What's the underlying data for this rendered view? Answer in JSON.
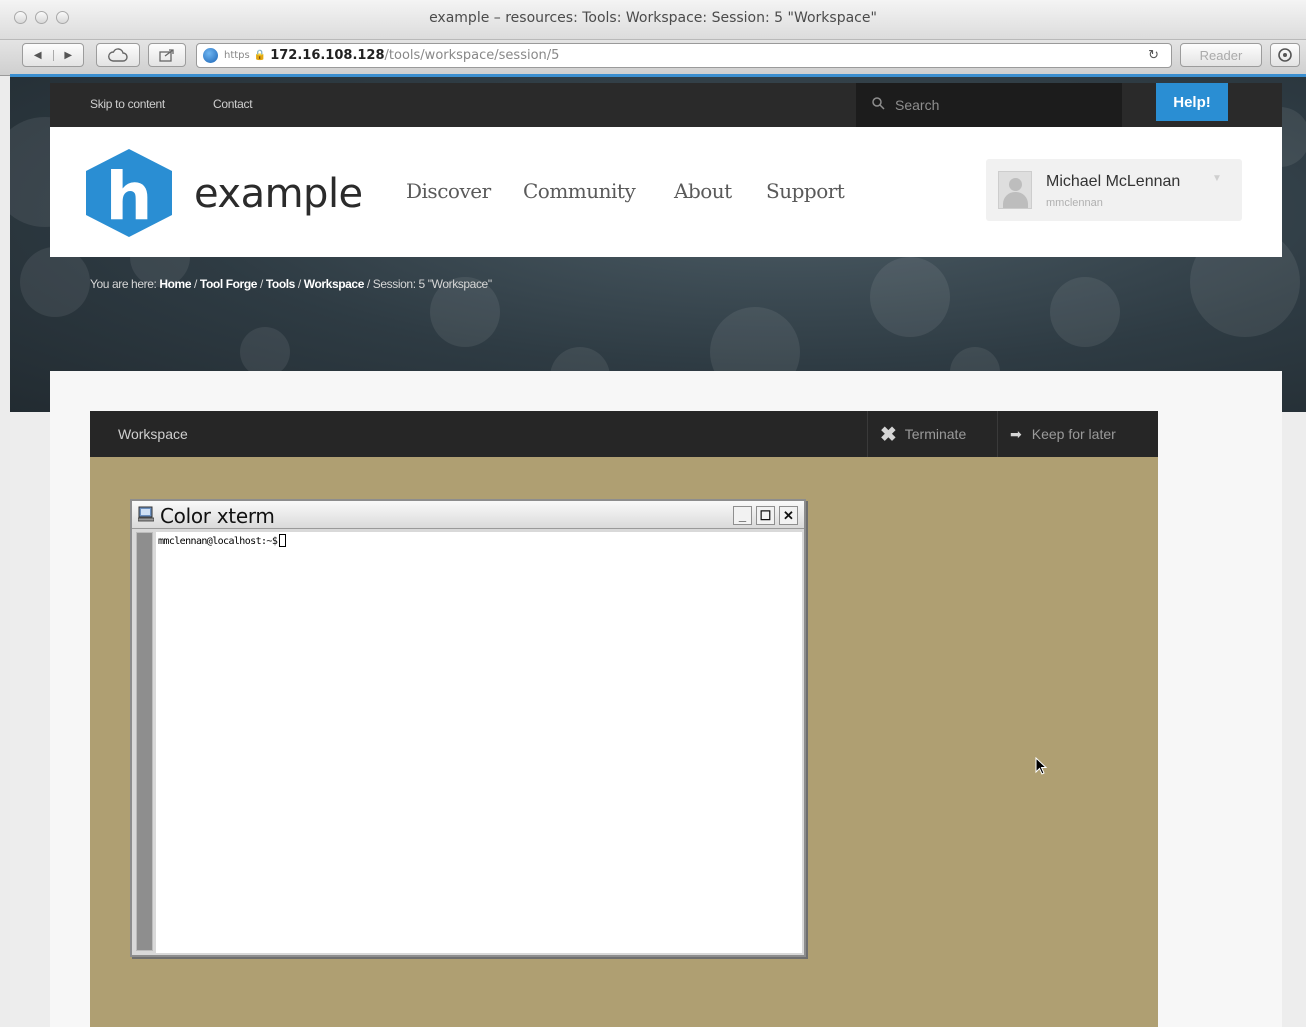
{
  "browser": {
    "window_title": "example – resources: Tools: Workspace: Session: 5 \"Workspace\"",
    "url_scheme": "https",
    "url_host": "172.16.108.128",
    "url_path": "/tools/workspace/session/5",
    "reader_label": "Reader",
    "back_icon": "back-arrow-icon",
    "forward_icon": "forward-arrow-icon"
  },
  "topnav": {
    "skip_label": "Skip to content",
    "contact_label": "Contact",
    "search_placeholder": "Search",
    "help_label": "Help!"
  },
  "header": {
    "logo_letter": "h",
    "site_name": "example",
    "nav": [
      "Discover",
      "Community",
      "About",
      "Support"
    ],
    "user_name": "Michael McLennan",
    "user_id": "mmclennan"
  },
  "breadcrumb": {
    "prefix": "You are here:",
    "items": [
      "Home",
      "Tool Forge",
      "Tools",
      "Workspace"
    ],
    "current": "Session: 5 \"Workspace\""
  },
  "workspace": {
    "title": "Workspace",
    "terminate_label": "Terminate",
    "keep_label": "Keep for later"
  },
  "xterm": {
    "title": "Color xterm",
    "prompt": "mmclennan@localhost:~$"
  },
  "colors": {
    "accent": "#2a8ed3",
    "desktop_bg": "#af9f72",
    "logo_blue": "#2a8ed3"
  }
}
